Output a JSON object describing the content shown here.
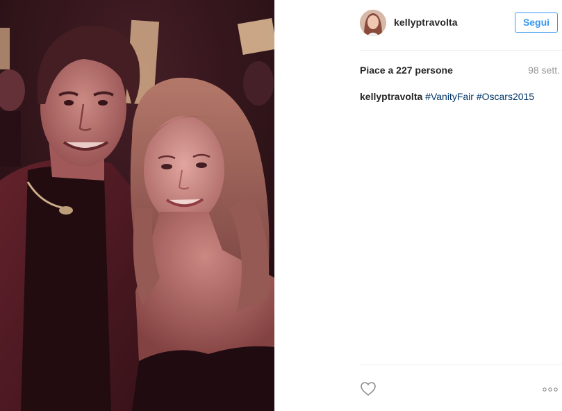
{
  "post": {
    "username": "kellyptravolta",
    "follow_label": "Segui",
    "likes_text": "Piace a 227 persone",
    "time_ago": "98 sett.",
    "caption": {
      "username": "kellyptravolta",
      "hashtags": [
        "#VanityFair",
        "#Oscars2015"
      ]
    }
  },
  "icons": {
    "like": "heart-outline-icon",
    "more": "ellipsis-horizontal-icon"
  },
  "colors": {
    "accent": "#3897f0",
    "hashtag": "#003569",
    "text": "#262626",
    "muted": "#999999",
    "divider": "#efefef"
  }
}
